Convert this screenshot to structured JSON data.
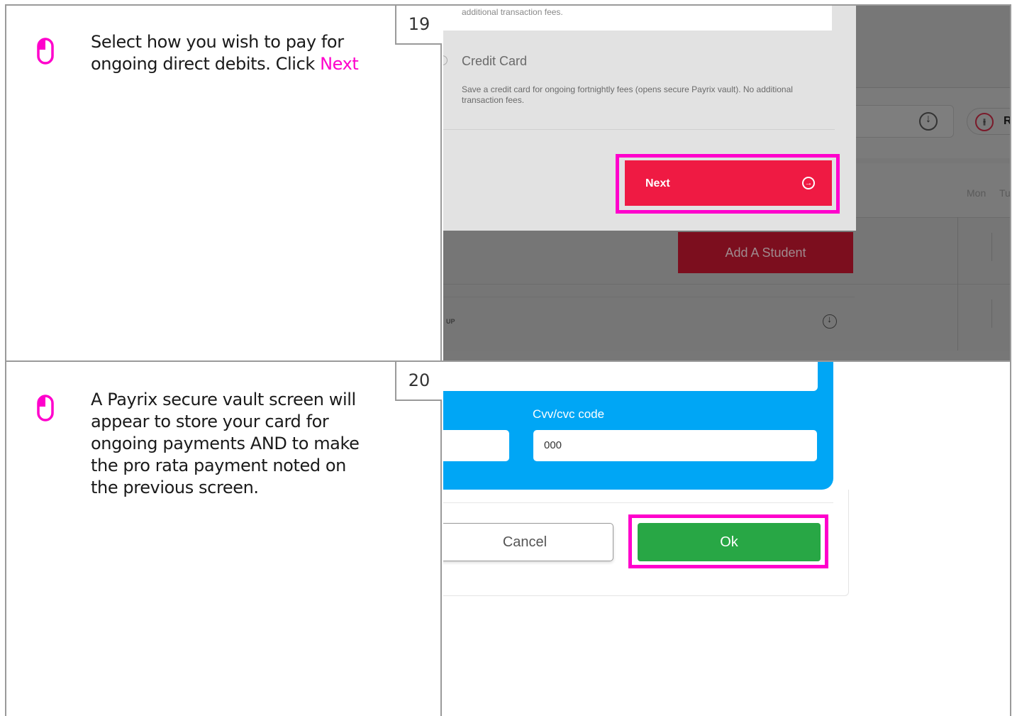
{
  "steps": [
    {
      "number": "19",
      "instruction_text": "Select how you wish to pay for ongoing direct debits. Click ",
      "instruction_highlight": "Next",
      "screenshot": {
        "top_text": "additional transaction fees.",
        "option_title": "Credit Card",
        "option_description": "Save a credit card for ongoing fortnightly fees (opens secure Payrix vault). No additional transaction fees.",
        "next_button_label": "Next",
        "add_student_label": "Add A Student",
        "filter_label": "Re",
        "day_labels": [
          "Mon",
          "Tu"
        ],
        "group_label": "UP"
      }
    },
    {
      "number": "20",
      "instruction_text": "A Payrix secure vault screen will appear to store your card for ongoing payments AND to make the pro rata payment noted on the previous screen.",
      "screenshot": {
        "cvv_label": "Cvv/cvc code",
        "cvv_value": "000",
        "cancel_label": "Cancel",
        "ok_label": "Ok"
      }
    }
  ],
  "colors": {
    "highlight": "#ff00cc",
    "next_button": "#ef1a43",
    "ok_button": "#28a745",
    "vault_blue": "#00a6f5"
  },
  "icons": [
    "mouse-icon",
    "arrow-circle-right-icon",
    "arrow-down-circle-icon",
    "filter-icon"
  ]
}
